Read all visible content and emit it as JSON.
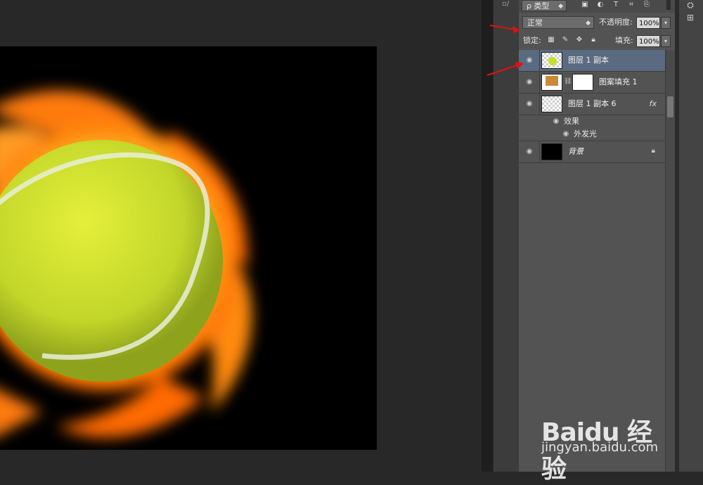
{
  "colors": {
    "accent_selected": "#5a6a80",
    "arrow": "#e01010",
    "ball": "#c8df2a",
    "fire": "#ff7a10"
  },
  "filter": {
    "kind_label": "ρ 类型",
    "icons": [
      "image-filter-icon",
      "adjustment-filter-icon",
      "type-filter-icon",
      "shape-filter-icon",
      "smart-object-filter-icon"
    ]
  },
  "blend": {
    "mode": "正常",
    "opacity_label": "不透明度:",
    "opacity_value": "100%"
  },
  "lock": {
    "label": "锁定:",
    "fill_label": "填充:",
    "fill_value": "100%"
  },
  "layers": [
    {
      "name": "图层 1 副本",
      "selected": true,
      "thumb": "tennis-ball-thumb"
    },
    {
      "name": "图案填充 1",
      "selected": false,
      "thumb": "pattern-fill-thumb"
    },
    {
      "name": "图层 1 副本 6",
      "selected": false,
      "thumb": "transparent-thumb",
      "fx": "fx",
      "effects_label": "效果",
      "effects": [
        "外发光"
      ]
    },
    {
      "name": "背景",
      "selected": false,
      "thumb": "black-thumb",
      "locked": true
    }
  ],
  "watermark": {
    "logo": "Baidu 经验",
    "url": "jingyan.baidu.com"
  }
}
